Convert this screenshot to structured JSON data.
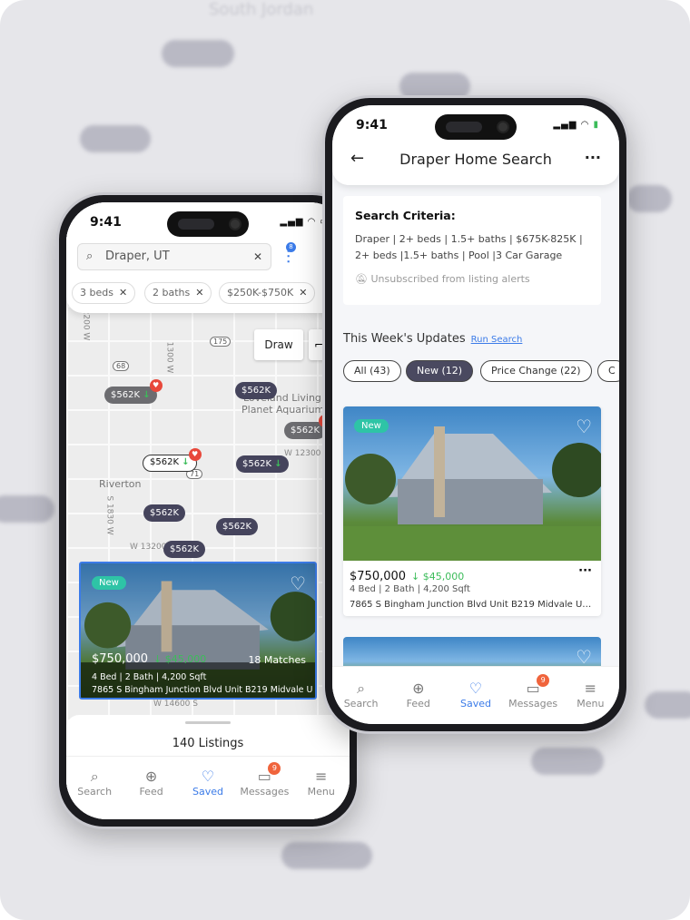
{
  "background": {
    "map_label": "South Jordan"
  },
  "status": {
    "time": "9:41"
  },
  "map_phone": {
    "search": {
      "value": "Draper, UT"
    },
    "filter_count": "8",
    "chips": [
      "3 beds",
      "2 baths",
      "$250K-$750K"
    ],
    "draw_label": "Draw",
    "map_labels": {
      "riverton": "Riverton",
      "aquarium_1": "Loveland Living",
      "aquarium_2": "Planet Aquarium",
      "w12300": "W 12300 S",
      "w13200": "W 13200 S",
      "w14600": "W 14600 S",
      "s1830": "S 1830 W",
      "w1300": "1300 W",
      "w2200": "2200 W"
    },
    "routes": [
      "175",
      "68",
      "71"
    ],
    "pin_price": "$562K",
    "listing": {
      "badge": "New",
      "price": "$750,000",
      "drop": "$45,000",
      "matches": "18 Matches",
      "beds": "4 Bed",
      "baths": "2 Bath",
      "sqft": "4,200 Sqft",
      "address": "7865 S Bingham Junction Blvd Unit B219 Midvale U"
    },
    "listings_count": "140 Listings"
  },
  "saved_phone": {
    "title": "Draper Home Search",
    "criteria_heading": "Search Criteria:",
    "criteria_text": "Draper | 2+ beds | 1.5+ baths | $675K-825K | 2+ beds |1.5+ baths | Pool |3 Car Garage",
    "alerts_status": "Unsubscribed from listing alerts",
    "updates_heading": "This Week's Updates",
    "run_search": "Run Search",
    "segments": [
      {
        "label": "All (43)",
        "selected": false
      },
      {
        "label": "New (12)",
        "selected": true
      },
      {
        "label": "Price Change (22)",
        "selected": false
      },
      {
        "label": "C",
        "selected": false
      }
    ],
    "listing": {
      "badge": "New",
      "price": "$750,000",
      "drop": "$45,000",
      "beds": "4 Bed",
      "baths": "2 Bath",
      "sqft": "4,200 Sqft",
      "address": "7865 S Bingham Junction Blvd Unit B219 Midvale UT..."
    }
  },
  "tabs": [
    {
      "label": "Search",
      "icon": "search-icon"
    },
    {
      "label": "Feed",
      "icon": "globe-icon"
    },
    {
      "label": "Saved",
      "icon": "heart-icon",
      "active": true
    },
    {
      "label": "Messages",
      "icon": "chat-icon",
      "badge": "9"
    },
    {
      "label": "Menu",
      "icon": "menu-icon"
    }
  ],
  "colors": {
    "accent": "#3b7be8",
    "pin": "#45445c",
    "drop": "#3cbc5a",
    "new_badge": "#2ec4a6",
    "favorite": "#e8483b"
  }
}
